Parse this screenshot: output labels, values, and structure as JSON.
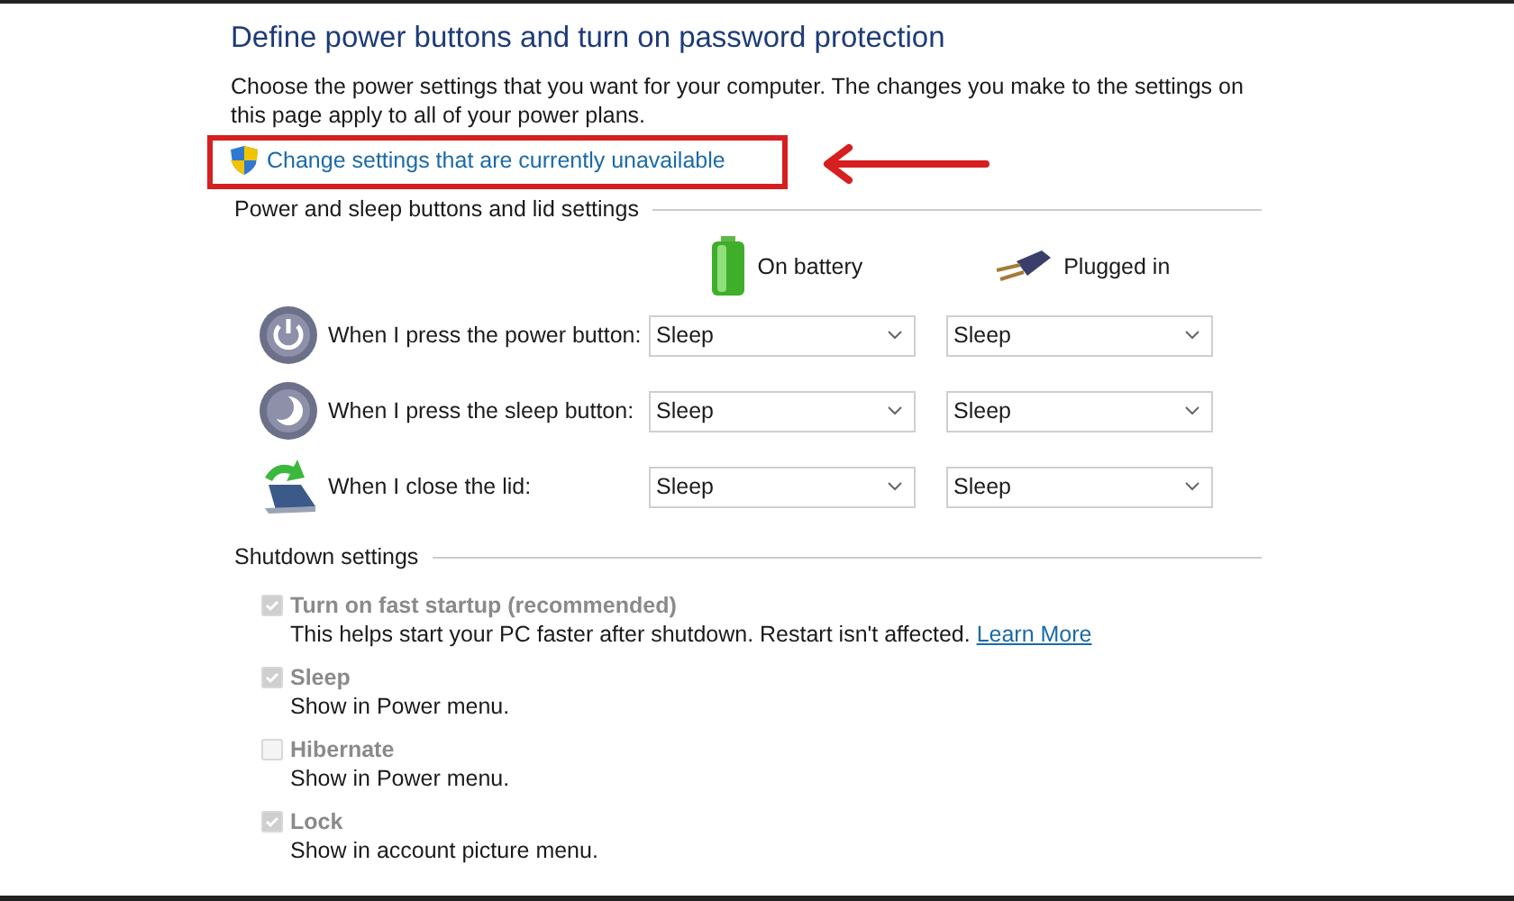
{
  "title": "Define power buttons and turn on password protection",
  "description": "Choose the power settings that you want for your computer. The changes you make to the settings on this page apply to all of your power plans.",
  "admin_link": "Change settings that are currently unavailable",
  "power_section": {
    "heading": "Power and sleep buttons and lid settings",
    "columns": [
      {
        "kind": "battery",
        "label": "On battery"
      },
      {
        "kind": "plug",
        "label": "Plugged in"
      }
    ],
    "rows": [
      {
        "kind": "power",
        "label": "When I press the power button:",
        "values": [
          "Sleep",
          "Sleep"
        ]
      },
      {
        "kind": "sleep",
        "label": "When I press the sleep button:",
        "values": [
          "Sleep",
          "Sleep"
        ]
      },
      {
        "kind": "lid",
        "label": "When I close the lid:",
        "values": [
          "Sleep",
          "Sleep"
        ]
      }
    ]
  },
  "shutdown_section": {
    "heading": "Shutdown settings",
    "options": [
      {
        "label": "Turn on fast startup (recommended)",
        "checked": true,
        "disabled": true,
        "description": "This helps start your PC faster after shutdown. Restart isn't affected.",
        "link": "Learn More"
      },
      {
        "label": "Sleep",
        "checked": true,
        "disabled": true,
        "description": "Show in Power menu."
      },
      {
        "label": "Hibernate",
        "checked": false,
        "disabled": true,
        "description": "Show in Power menu."
      },
      {
        "label": "Lock",
        "checked": true,
        "disabled": true,
        "description": "Show in account picture menu."
      }
    ]
  }
}
